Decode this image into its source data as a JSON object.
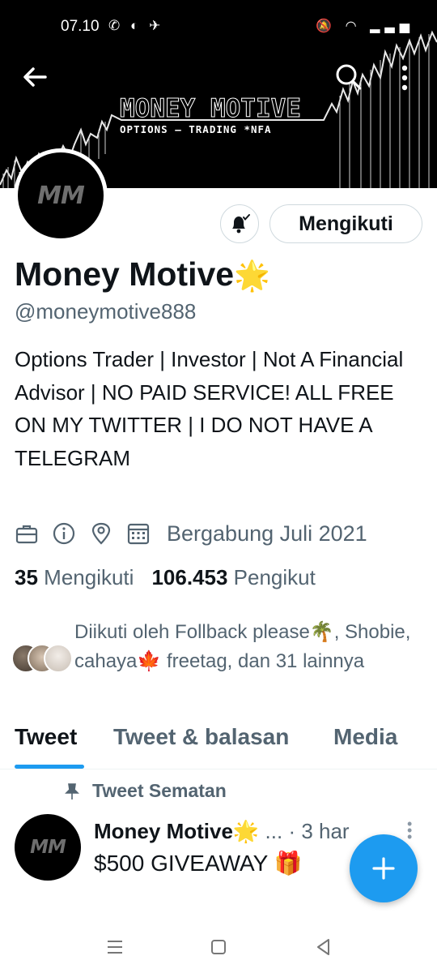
{
  "status_bar": {
    "time": "07.10",
    "app_icons": "✆ ◐ ✈",
    "system_icons": "🔕 ◠ ▂▃▅"
  },
  "banner": {
    "brand_title": "MONEY MOTIVE",
    "brand_subtitle": "OPTIONS — TRADING   *NFA"
  },
  "profile": {
    "avatar_text": "MM",
    "follow_label": "Mengikuti",
    "name": "Money Motive",
    "name_emoji": "🌟",
    "handle": "@moneymotive888",
    "bio": "Options Trader | Investor | Not A Financial Advisor | NO PAID SERVICE! ALL FREE ON MY TWITTER | I DO NOT HAVE A TELEGRAM",
    "joined": "Bergabung Juli 2021",
    "following_count": "35",
    "following_label": "Mengikuti",
    "followers_count": "106.453",
    "followers_label": "Pengikut",
    "followed_by": "Diikuti oleh Follback please🌴, Shobie, cahaya🍁 freetag, dan 31 lainnya"
  },
  "tabs": [
    {
      "label": "Tweet"
    },
    {
      "label": "Tweet & balasan"
    },
    {
      "label": "Media"
    }
  ],
  "pinned_tweet": {
    "pinned_label": "Tweet Sematan",
    "author": "Money Motive",
    "author_emoji": "🌟",
    "ellipsis": "...",
    "time": "· 3 har",
    "text": "$500 GIVEAWAY",
    "text_emoji": "🎁"
  },
  "colors": {
    "accent": "#1d9bf0",
    "muted_text": "#536471",
    "text": "#0f1419"
  }
}
